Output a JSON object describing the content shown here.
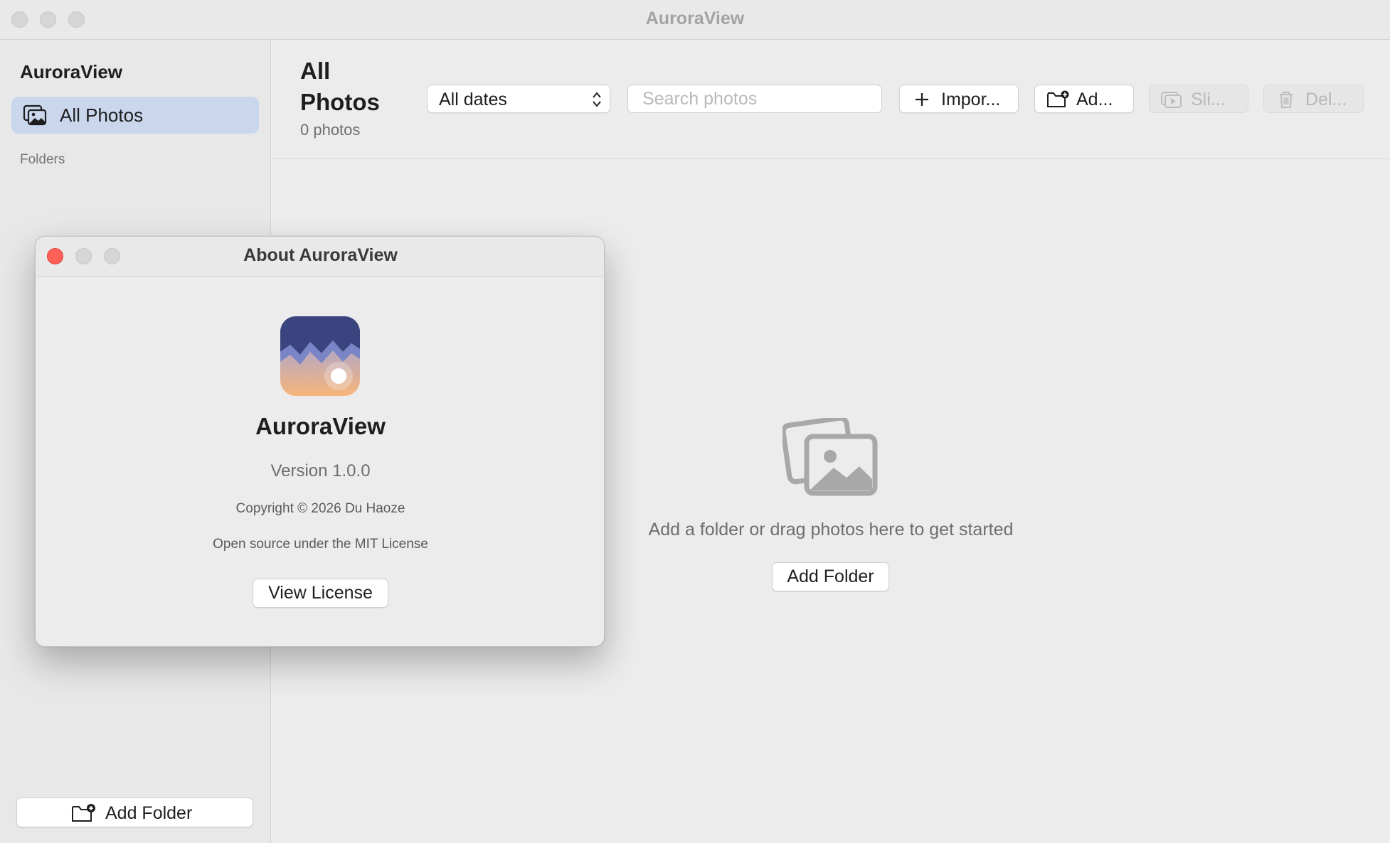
{
  "window": {
    "title": "AuroraView"
  },
  "sidebar": {
    "app_name": "AuroraView",
    "items": [
      {
        "label": "All Photos",
        "icon": "photos-icon",
        "selected": true
      }
    ],
    "folders_heading": "Folders",
    "add_folder_label": "Add Folder"
  },
  "main": {
    "title": "All Photos",
    "photo_count": "0 photos",
    "date_filter": {
      "selected": "All dates"
    },
    "search": {
      "placeholder": "Search photos",
      "value": ""
    },
    "toolbar": {
      "import_label": "Impor...",
      "add_folder_label": "Ad...",
      "slideshow_label": "Sli...",
      "delete_label": "Del..."
    },
    "empty_state": {
      "message": "Add a folder or drag photos here to get started",
      "add_folder_label": "Add Folder"
    }
  },
  "about_dialog": {
    "title": "About AuroraView",
    "app_name": "AuroraView",
    "version": "Version 1.0.0",
    "copyright": "Copyright © 2026 Du Haoze",
    "license_text": "Open source under the MIT License",
    "view_license_label": "View License"
  },
  "colors": {
    "selection": "#c9d6ec",
    "close_button": "#fe5f57",
    "icon_sky": "#3a447f",
    "icon_sunrise": "#f2b27e"
  }
}
